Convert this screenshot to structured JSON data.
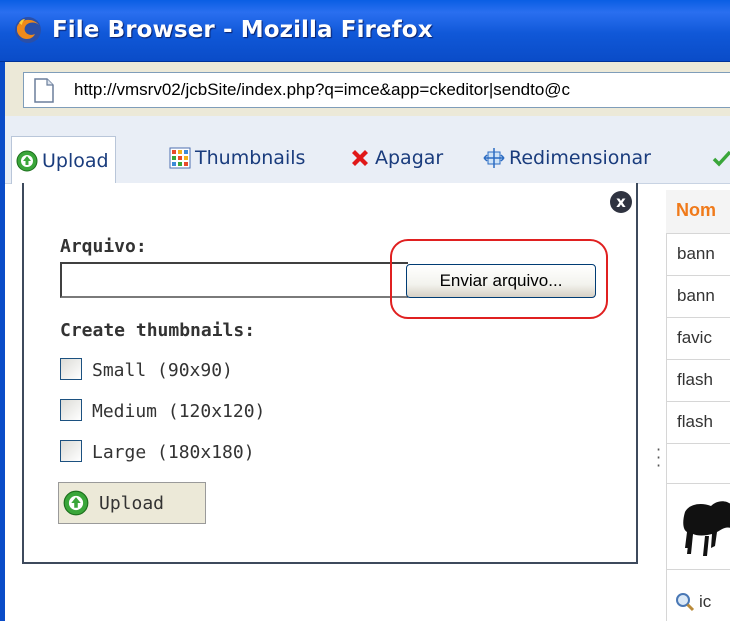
{
  "window": {
    "title": "File Browser - Mozilla Firefox"
  },
  "address": {
    "url": "http://vmsrv02/jcbSite/index.php?q=imce&app=ckeditor|sendto@c"
  },
  "toolbar": {
    "upload_label": "Upload",
    "thumbnails_label": "Thumbnails",
    "delete_label": "Apagar",
    "resize_label": "Redimensionar"
  },
  "upload_panel": {
    "close_label": "x",
    "file_label": "Arquivo:",
    "browse_label": "Enviar arquivo...",
    "thumbnails_heading": "Create thumbnails:",
    "options": [
      {
        "label": "Small (90x90)",
        "checked": false
      },
      {
        "label": "Medium (120x120)",
        "checked": false
      },
      {
        "label": "Large (180x180)",
        "checked": false
      }
    ],
    "upload_button_label": "Upload"
  },
  "file_list": {
    "header": "Nom",
    "rows": [
      "bann",
      "bann",
      "favic",
      "flash",
      "flash"
    ],
    "last_row": "ic"
  },
  "colors": {
    "titlebar": "#0a5ee3",
    "highlight": "#e02020",
    "header_text": "#f07a1a"
  }
}
